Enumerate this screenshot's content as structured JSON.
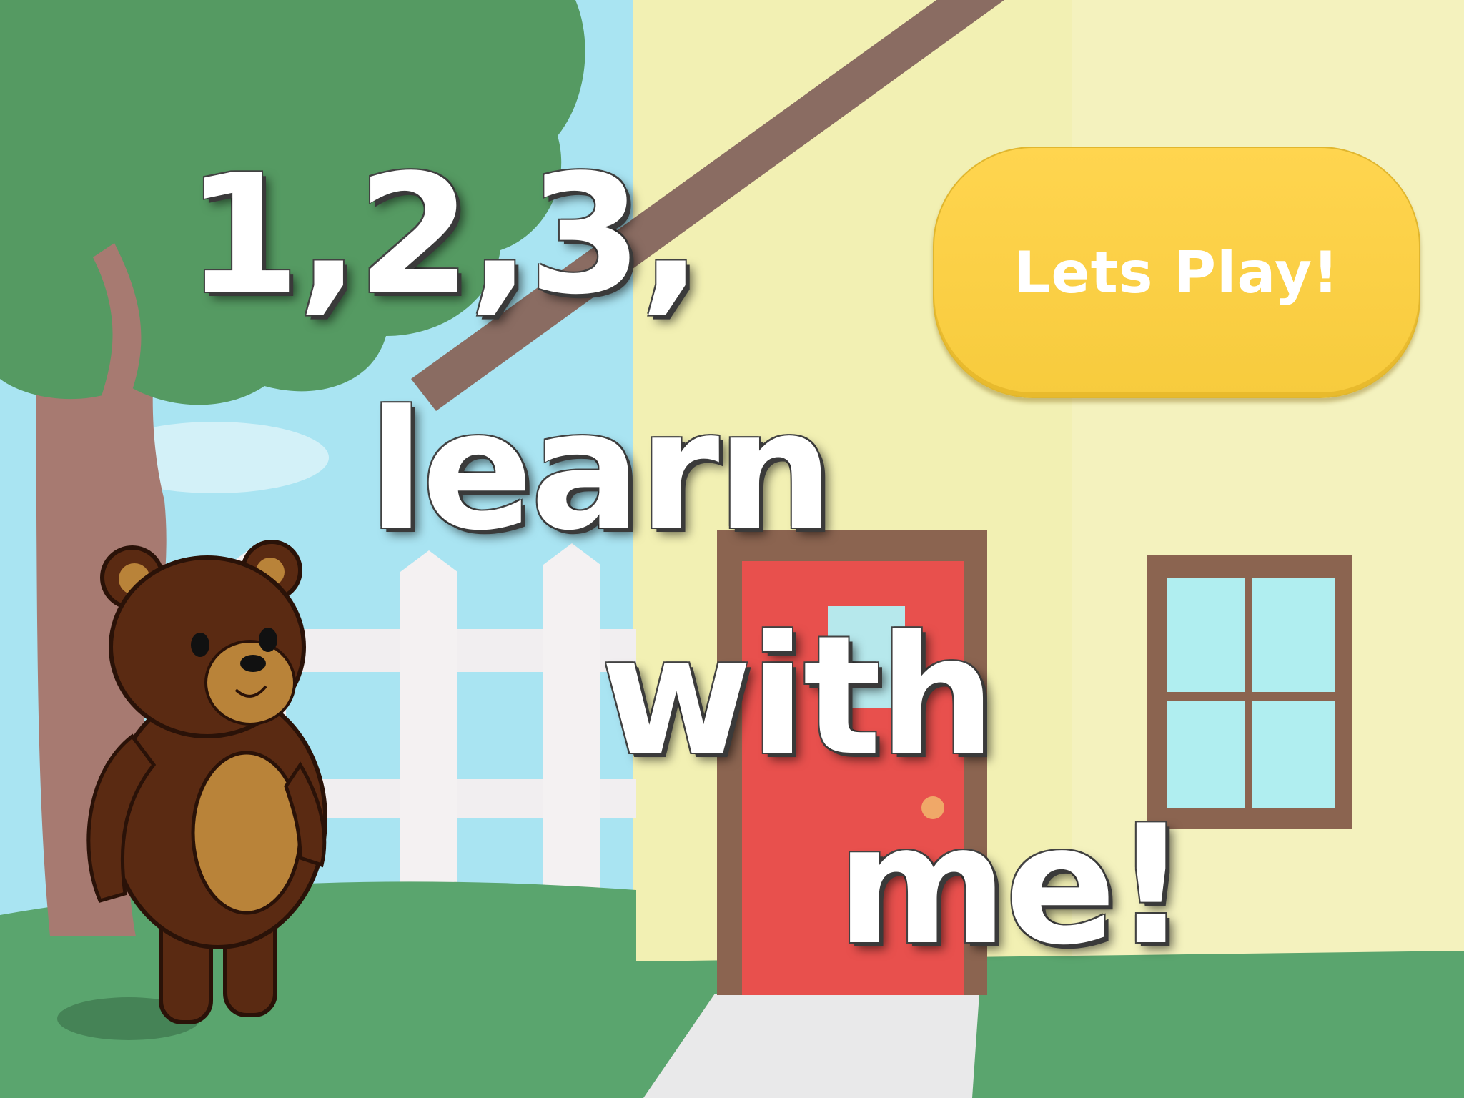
{
  "title": {
    "line1": "1,2,3,",
    "line2": "learn",
    "line3": "with",
    "line4": "me!"
  },
  "play_button": {
    "label": "Lets Play!"
  },
  "colors": {
    "sky": "#a9e4f2",
    "grass": "#5aa56e",
    "wall": "#f3f0b0",
    "door": "#e8504d",
    "door_frame": "#8b6450",
    "button": "#ffd54f",
    "foliage": "#559a62",
    "bear_fur": "#5a2a12",
    "bear_belly": "#b98339"
  },
  "icons": [
    "bear-character",
    "tree",
    "house",
    "fence"
  ]
}
